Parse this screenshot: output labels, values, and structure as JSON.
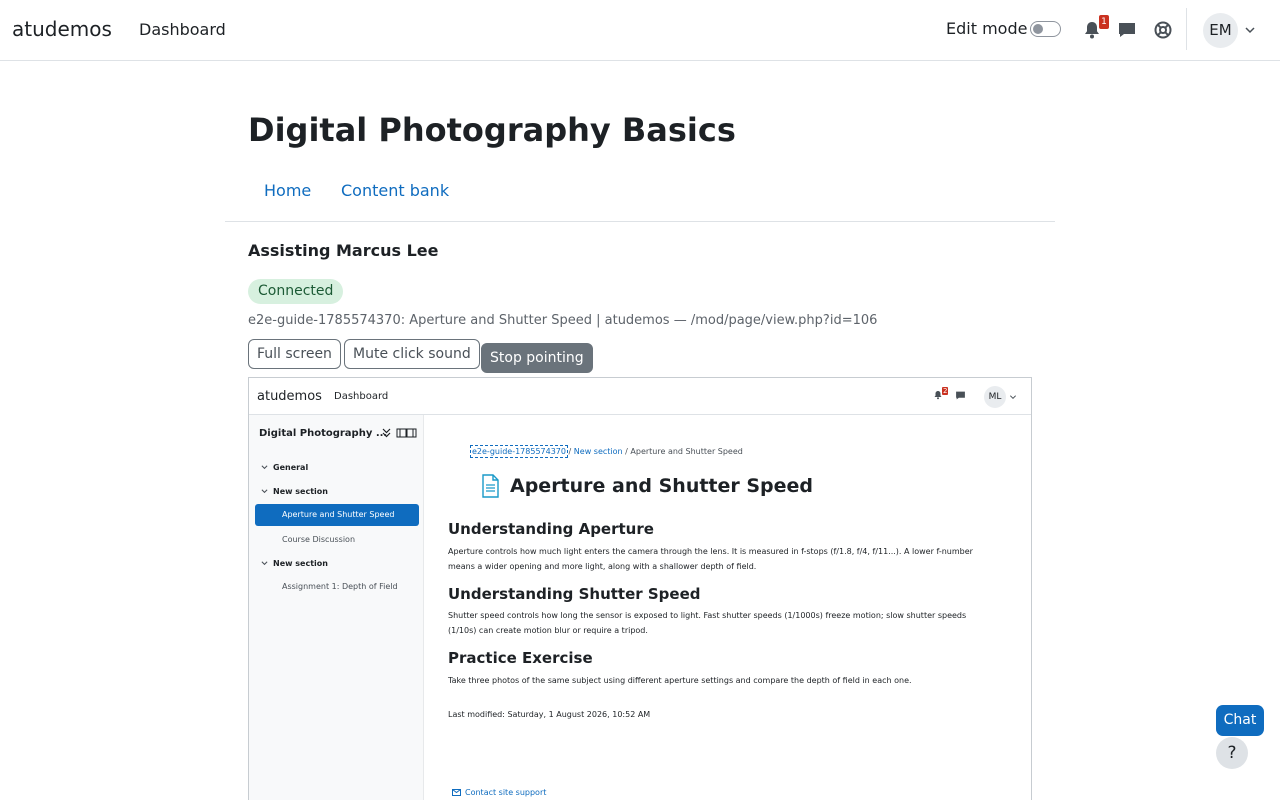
{
  "header": {
    "brand": "atudemos",
    "nav_dashboard": "Dashboard",
    "edit_mode_label": "Edit mode",
    "notification_count": "1",
    "avatar_initials": "EM"
  },
  "course": {
    "title": "Digital Photography Basics",
    "nav": [
      "Home",
      "Content bank"
    ]
  },
  "assist": {
    "heading": "Assisting Marcus Lee",
    "status": "Connected",
    "page_info": "e2e-guide-1785574370: Aperture and Shutter Speed | atudemos — /mod/page/view.php?id=106",
    "buttons": {
      "full_screen": "Full screen",
      "mute": "Mute click sound",
      "stop": "Stop pointing"
    }
  },
  "remote": {
    "brand": "atudemos",
    "nav_dashboard": "Dashboard",
    "notification_count": "2",
    "avatar_initials": "ML",
    "sidebar": {
      "course_name": "Digital Photography ...",
      "items": [
        {
          "label": "General"
        },
        {
          "label": "New section"
        },
        {
          "label": "Aperture and Shutter Speed"
        },
        {
          "label": "Course Discussion"
        },
        {
          "label": "New section"
        },
        {
          "label": "Assignment 1: Depth of Field"
        }
      ]
    },
    "breadcrumb": {
      "course": "e2e-guide-1785574370",
      "section": "New section",
      "page": "Aperture and Shutter Speed"
    },
    "page_title": "Aperture and Shutter Speed",
    "content": [
      {
        "heading": "Understanding Aperture",
        "text": "Aperture controls how much light enters the camera through the lens. It is measured in f-stops (f/1.8, f/4, f/11...). A lower f-number means a wider opening and more light, along with a shallower depth of field."
      },
      {
        "heading": "Understanding Shutter Speed",
        "text": "Shutter speed controls how long the sensor is exposed to light. Fast shutter speeds (1/1000s) freeze motion; slow shutter speeds (1/10s) can create motion blur or require a tripod."
      },
      {
        "heading": "Practice Exercise",
        "text": "Take three photos of the same subject using different aperture settings and compare the depth of field in each one."
      }
    ],
    "last_modified": "Last modified: Saturday, 1 August 2026, 10:52 AM",
    "support_link": "Contact site support"
  },
  "floating": {
    "chat": "Chat",
    "help": "?"
  },
  "colors": {
    "accent": "#0f6cbf",
    "badge": "#ca3120",
    "connected_bg": "#d7f0df"
  }
}
